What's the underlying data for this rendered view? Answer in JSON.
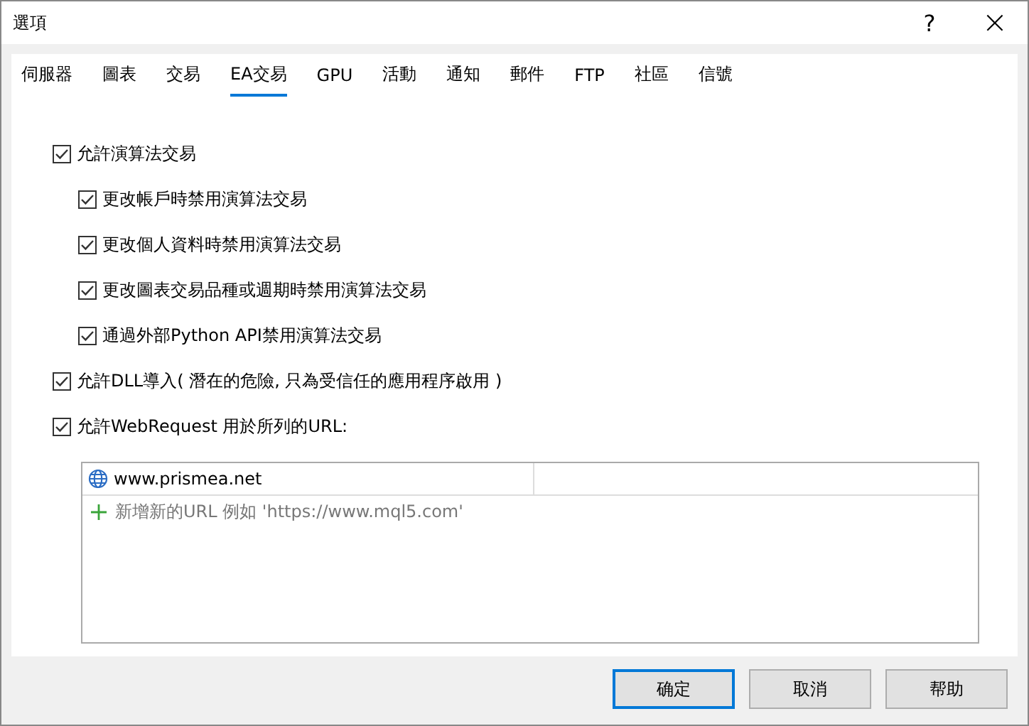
{
  "window": {
    "title": "選項",
    "help": "?",
    "close": "×"
  },
  "tabs": [
    {
      "label": "伺服器",
      "selected": false
    },
    {
      "label": "圖表",
      "selected": false
    },
    {
      "label": "交易",
      "selected": false
    },
    {
      "label": "EA交易",
      "selected": true
    },
    {
      "label": "GPU",
      "selected": false
    },
    {
      "label": "活動",
      "selected": false
    },
    {
      "label": "通知",
      "selected": false
    },
    {
      "label": "郵件",
      "selected": false
    },
    {
      "label": "FTP",
      "selected": false
    },
    {
      "label": "社區",
      "selected": false
    },
    {
      "label": "信號",
      "selected": false
    }
  ],
  "options": [
    {
      "label": "允許演算法交易",
      "checked": true,
      "children": [
        {
          "label": "更改帳戶時禁用演算法交易",
          "checked": true
        },
        {
          "label": "更改個人資料時禁用演算法交易",
          "checked": true
        },
        {
          "label": "更改圖表交易品種或週期時禁用演算法交易",
          "checked": true
        },
        {
          "label": "通過外部Python API禁用演算法交易",
          "checked": true
        }
      ]
    },
    {
      "label": "允許DLL導入( 潛在的危險, 只為受信任的應用程序啟用 )",
      "checked": true
    },
    {
      "label": "允許WebRequest 用於所列的URL:",
      "checked": true
    }
  ],
  "url_list": {
    "rows": [
      "www.prismea.net"
    ],
    "add_row": "新增新的URL 例如 'https://www.mql5.com'"
  },
  "buttons": [
    {
      "label": "确定",
      "default": true
    },
    {
      "label": "取消",
      "default": false
    },
    {
      "label": "帮助",
      "default": false
    }
  ]
}
